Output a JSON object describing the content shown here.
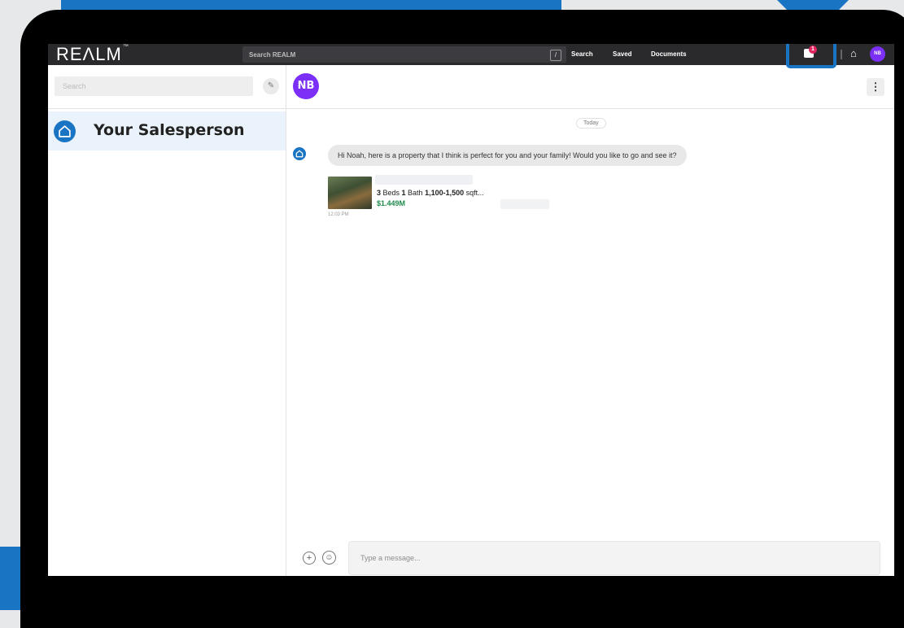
{
  "colors": {
    "accent": "#1a74c4",
    "avatar_purple": "#7b2ff7",
    "price_green": "#1f8a4c",
    "nav_bg": "#2a2a2c",
    "badge_red": "#e0245e"
  },
  "topnav": {
    "logo": "REΛLM",
    "logo_tm": "™",
    "search_placeholder": "Search REALM",
    "slash_hint": "/",
    "links": [
      "Search",
      "Saved",
      "Documents"
    ],
    "chat_badge_count": "1",
    "user_initials": "NB",
    "icons": [
      "chat-icon",
      "home-icon"
    ]
  },
  "sidebar": {
    "search_placeholder": "Search",
    "compose_icon": "compose-icon",
    "conversations": [
      {
        "name": "Your Salesperson",
        "icon": "home-icon"
      }
    ]
  },
  "chat": {
    "header_initials": "NB",
    "menu_icon": "kebab-menu-icon",
    "date_label": "Today",
    "messages": [
      {
        "text": "Hi Noah, here is a property that I think is perfect for you and your family! Would you like to go and see it?",
        "listing": {
          "beds_num": "3",
          "beds_label": " Beds ",
          "bath_num": "1",
          "bath_label": " Bath ",
          "sqft_range": "1,100-1,500",
          "sqft_label": " sqft...",
          "price": "$1.449M"
        },
        "time": "12:03 PM"
      }
    ],
    "composer": {
      "placeholder": "Type a message...",
      "icons": [
        "add-icon",
        "emoji-icon"
      ]
    }
  }
}
